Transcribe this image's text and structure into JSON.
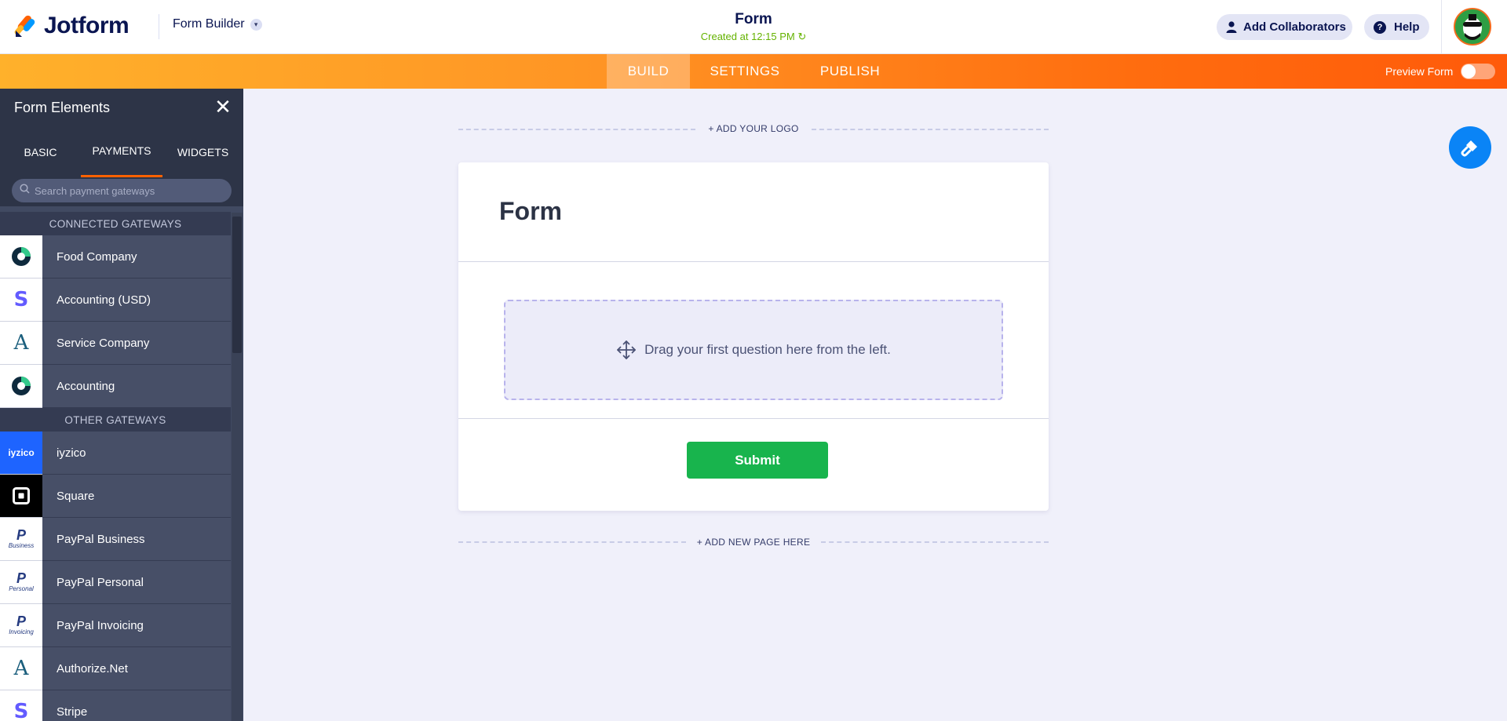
{
  "header": {
    "brand": "Jotform",
    "builder_select": "Form Builder",
    "form_title": "Form",
    "created_text": "Created at 12:15 PM",
    "add_collaborators": "Add Collaborators",
    "help": "Help"
  },
  "nav": {
    "tabs": [
      {
        "label": "BUILD",
        "active": true
      },
      {
        "label": "SETTINGS",
        "active": false
      },
      {
        "label": "PUBLISH",
        "active": false
      }
    ],
    "preview_label": "Preview Form",
    "preview_on": false
  },
  "sidebar": {
    "title": "Form Elements",
    "tabs": [
      {
        "label": "BASIC",
        "active": false
      },
      {
        "label": "PAYMENTS",
        "active": true
      },
      {
        "label": "WIDGETS",
        "active": false
      }
    ],
    "search_placeholder": "Search payment gateways",
    "connected_header": "CONNECTED GATEWAYS",
    "connected": [
      {
        "label": "Food Company",
        "icon": "food-company-logo-icon"
      },
      {
        "label": "Accounting (USD)",
        "icon": "stripe-s-icon"
      },
      {
        "label": "Service Company",
        "icon": "authorize-a-icon"
      },
      {
        "label": "Accounting",
        "icon": "food-company-logo-icon"
      }
    ],
    "other_header": "OTHER GATEWAYS",
    "other": [
      {
        "label": "iyzico",
        "icon": "iyzico-logo-icon",
        "logo_text": "iyzico"
      },
      {
        "label": "Square",
        "icon": "square-logo-icon"
      },
      {
        "label": "PayPal Business",
        "icon": "paypal-logo-icon",
        "caption": "Business"
      },
      {
        "label": "PayPal Personal",
        "icon": "paypal-logo-icon",
        "caption": "Personal"
      },
      {
        "label": "PayPal Invoicing",
        "icon": "paypal-logo-icon",
        "caption": "Invoicing"
      },
      {
        "label": "Authorize.Net",
        "icon": "authorize-a-icon"
      },
      {
        "label": "Stripe",
        "icon": "stripe-s-icon"
      }
    ]
  },
  "canvas": {
    "add_logo": "+ ADD YOUR LOGO",
    "form_heading": "Form",
    "drop_hint": "Drag your first question here from the left.",
    "submit": "Submit",
    "add_page": "+ ADD NEW PAGE HERE"
  },
  "colors": {
    "accent_orange": "#ff6100",
    "submit_green": "#18b44d",
    "designer_blue": "#0a84f6",
    "sidebar_bg": "#414a62",
    "created_green": "#64b200"
  }
}
